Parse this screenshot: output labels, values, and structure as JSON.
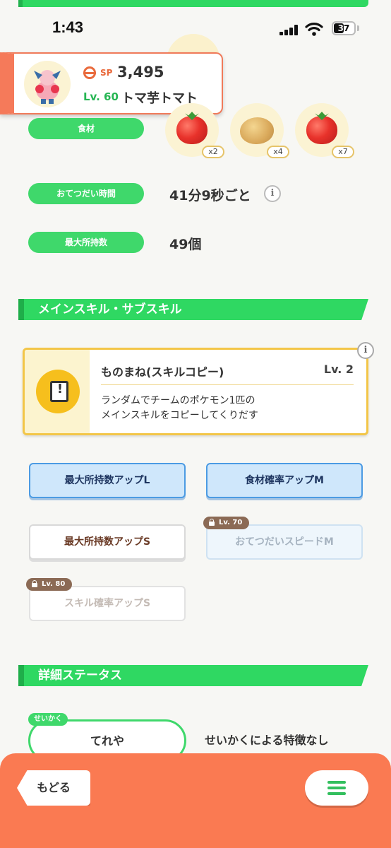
{
  "status_bar": {
    "time": "1:43",
    "battery": "37"
  },
  "pokemon": {
    "sp_label": "SP",
    "sp_value": "3,495",
    "level": "Lv. 60",
    "name": "トマ芋トマト"
  },
  "labels": {
    "ingredients": "食材",
    "help_time": "おてつだい時間",
    "max_carry": "最大所持数"
  },
  "ingredients": [
    {
      "icon": "tomato-icon",
      "count": "x2"
    },
    {
      "icon": "potato-icon",
      "count": "x4"
    },
    {
      "icon": "tomato-icon",
      "count": "x7"
    }
  ],
  "help_time_value": "41分9秒ごと",
  "max_carry_value": "49個",
  "info_glyph": "i",
  "section_skills": "メインスキル・サブスキル",
  "main_skill": {
    "name": "ものまね(スキルコピー)",
    "level": "Lv. 2",
    "desc_line1": "ランダムでチームのポケモン1匹の",
    "desc_line2": "メインスキルをコピーしてくりだす"
  },
  "sub_skills": [
    {
      "label": "最大所持数アップL"
    },
    {
      "label": "食材確率アップM"
    },
    {
      "label": "最大所持数アップS"
    },
    {
      "label": "おてつだいスピードM",
      "lock": "Lv. 70"
    },
    {
      "label": "スキル確率アップS",
      "lock": "Lv. 80"
    }
  ],
  "section_details": "詳細ステータス",
  "nature": {
    "tag": "せいかく",
    "value": "てれや",
    "desc": "せいかくによる特徴なし"
  },
  "nav": {
    "back_label": "もどる"
  },
  "colors": {
    "accent_green": "#3fd86b",
    "bottom_bar": "#fa7a52",
    "card_border": "#f07a5a",
    "skill_gold": "#f3c648"
  }
}
